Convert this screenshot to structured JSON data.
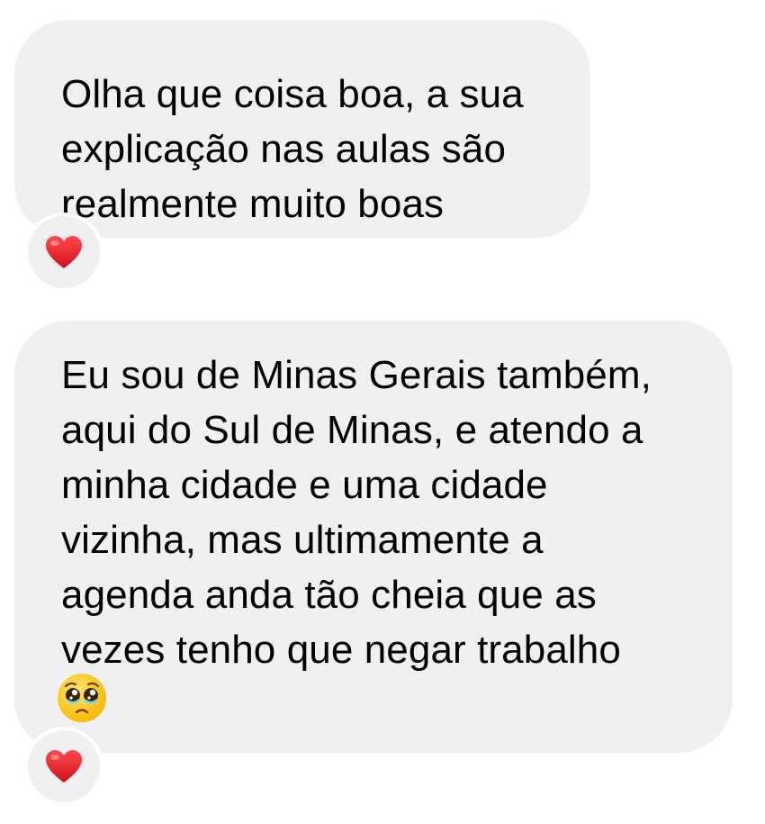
{
  "messages": [
    {
      "text": "Olha que coisa boa, a sua\nexplicação nas aulas são\nrealmente muito boas",
      "reaction": "red-heart"
    },
    {
      "text": "Eu sou de Minas Gerais também,\naqui do Sul de Minas, e atendo a\nminha cidade e uma cidade\nvizinha, mas ultimamente a\nagenda anda tão cheia que as\nvezes tenho que negar trabalho",
      "trailing_emoji": "pleading-face",
      "reaction": "red-heart"
    }
  ],
  "colors": {
    "bubble": "#f0f0f3",
    "text": "#000000",
    "heart": "#e0161c"
  }
}
